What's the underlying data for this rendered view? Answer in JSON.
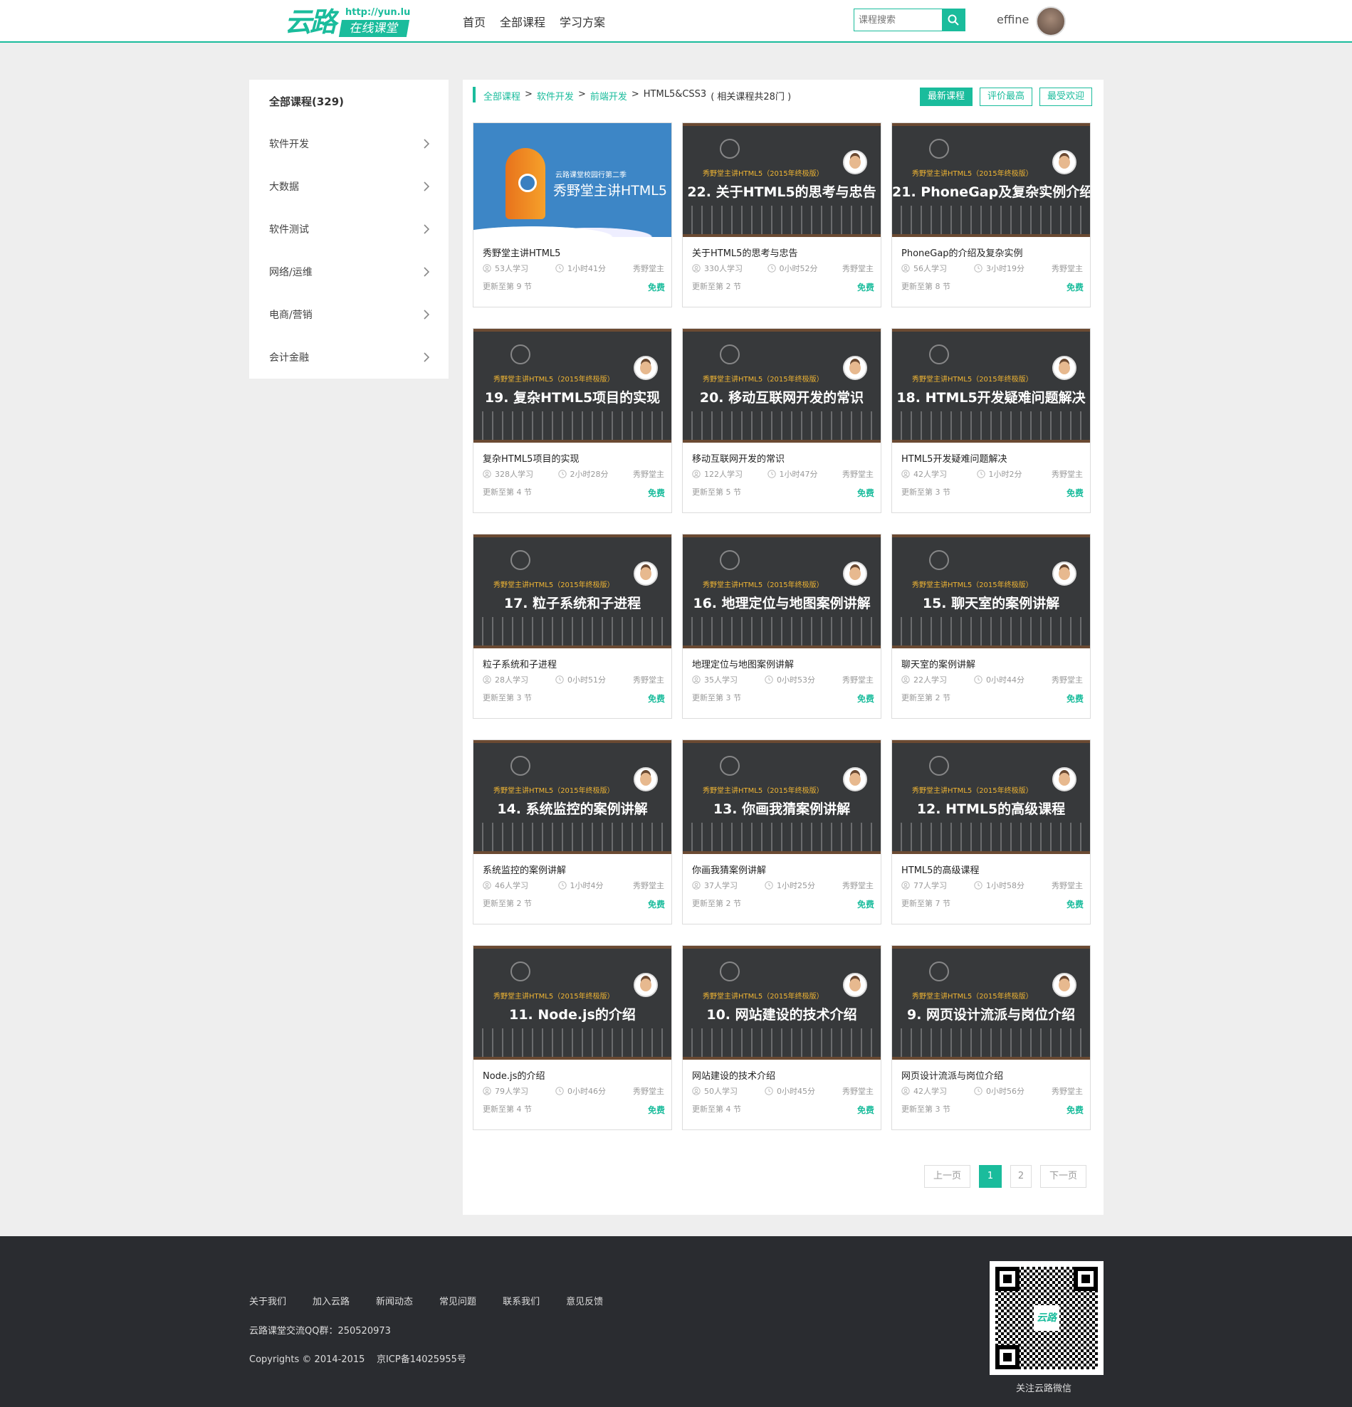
{
  "header": {
    "logo_main": "云路",
    "logo_url": "http://yun.lu",
    "logo_tag": "在线课堂",
    "nav": [
      "首页",
      "全部课程",
      "学习方案"
    ],
    "search_placeholder": "课程搜索",
    "username": "effine"
  },
  "sidebar": {
    "header": "全部课程(329)",
    "items": [
      "软件开发",
      "大数据",
      "软件测试",
      "网络/运维",
      "电商/营销",
      "会计金融"
    ]
  },
  "breadcrumb": {
    "items": [
      "全部课程",
      "软件开发",
      "前端开发",
      "HTML5&CSS3"
    ],
    "sep": ">",
    "count": "( 相关课程共28门 )"
  },
  "sort": [
    "最新课程",
    "评价最高",
    "最受欢迎"
  ],
  "courses": [
    {
      "thumb_sub": "云路课堂校园行第二季",
      "thumb_title": "秀野堂主讲HTML5",
      "title": "秀野堂主讲HTML5",
      "learners": "53人学习",
      "duration": "1小时41分",
      "teacher": "秀野堂主",
      "update": "更新至第 9 节",
      "price": "免费"
    },
    {
      "thumb_sub": "秀野堂主讲HTML5（2015年终极版）",
      "thumb_title": "22. 关于HTML5的思考与忠告",
      "title": "关于HTML5的思考与忠告",
      "learners": "330人学习",
      "duration": "0小时52分",
      "teacher": "秀野堂主",
      "update": "更新至第 2 节",
      "price": "免费"
    },
    {
      "thumb_sub": "秀野堂主讲HTML5（2015年终极版）",
      "thumb_title": "21. PhoneGap及复杂实例介绍",
      "title": "PhoneGap的介绍及复杂实例",
      "learners": "56人学习",
      "duration": "3小时19分",
      "teacher": "秀野堂主",
      "update": "更新至第 8 节",
      "price": "免费"
    },
    {
      "thumb_sub": "秀野堂主讲HTML5（2015年终极版）",
      "thumb_title": "19. 复杂HTML5项目的实现",
      "title": "复杂HTML5项目的实现",
      "learners": "328人学习",
      "duration": "2小时28分",
      "teacher": "秀野堂主",
      "update": "更新至第 4 节",
      "price": "免费"
    },
    {
      "thumb_sub": "秀野堂主讲HTML5（2015年终极版）",
      "thumb_title": "20. 移动互联网开发的常识",
      "title": "移动互联网开发的常识",
      "learners": "122人学习",
      "duration": "1小时47分",
      "teacher": "秀野堂主",
      "update": "更新至第 5 节",
      "price": "免费"
    },
    {
      "thumb_sub": "秀野堂主讲HTML5（2015年终极版）",
      "thumb_title": "18. HTML5开发疑难问题解决",
      "title": "HTML5开发疑难问题解决",
      "learners": "42人学习",
      "duration": "1小时2分",
      "teacher": "秀野堂主",
      "update": "更新至第 3 节",
      "price": "免费"
    },
    {
      "thumb_sub": "秀野堂主讲HTML5（2015年终极版）",
      "thumb_title": "17. 粒子系统和子进程",
      "title": "粒子系统和子进程",
      "learners": "28人学习",
      "duration": "0小时51分",
      "teacher": "秀野堂主",
      "update": "更新至第 3 节",
      "price": "免费"
    },
    {
      "thumb_sub": "秀野堂主讲HTML5（2015年终极版）",
      "thumb_title": "16. 地理定位与地图案例讲解",
      "title": "地理定位与地图案例讲解",
      "learners": "35人学习",
      "duration": "0小时53分",
      "teacher": "秀野堂主",
      "update": "更新至第 3 节",
      "price": "免费"
    },
    {
      "thumb_sub": "秀野堂主讲HTML5（2015年终极版）",
      "thumb_title": "15. 聊天室的案例讲解",
      "title": "聊天室的案例讲解",
      "learners": "22人学习",
      "duration": "0小时44分",
      "teacher": "秀野堂主",
      "update": "更新至第 2 节",
      "price": "免费"
    },
    {
      "thumb_sub": "秀野堂主讲HTML5（2015年终极版）",
      "thumb_title": "14. 系统监控的案例讲解",
      "title": "系统监控的案例讲解",
      "learners": "46人学习",
      "duration": "1小时4分",
      "teacher": "秀野堂主",
      "update": "更新至第 2 节",
      "price": "免费"
    },
    {
      "thumb_sub": "秀野堂主讲HTML5（2015年终极版）",
      "thumb_title": "13. 你画我猜案例讲解",
      "title": "你画我猜案例讲解",
      "learners": "37人学习",
      "duration": "1小时25分",
      "teacher": "秀野堂主",
      "update": "更新至第 2 节",
      "price": "免费"
    },
    {
      "thumb_sub": "秀野堂主讲HTML5（2015年终极版）",
      "thumb_title": "12. HTML5的高级课程",
      "title": "HTML5的高级课程",
      "learners": "77人学习",
      "duration": "1小时58分",
      "teacher": "秀野堂主",
      "update": "更新至第 7 节",
      "price": "免费"
    },
    {
      "thumb_sub": "秀野堂主讲HTML5（2015年终极版）",
      "thumb_title": "11. Node.js的介绍",
      "title": "Node.js的介绍",
      "learners": "79人学习",
      "duration": "0小时46分",
      "teacher": "秀野堂主",
      "update": "更新至第 4 节",
      "price": "免费"
    },
    {
      "thumb_sub": "秀野堂主讲HTML5（2015年终极版）",
      "thumb_title": "10. 网站建设的技术介绍",
      "title": "网站建设的技术介绍",
      "learners": "50人学习",
      "duration": "0小时45分",
      "teacher": "秀野堂主",
      "update": "更新至第 4 节",
      "price": "免费"
    },
    {
      "thumb_sub": "秀野堂主讲HTML5（2015年终极版）",
      "thumb_title": "9. 网页设计流派与岗位介绍",
      "title": "网页设计流派与岗位介绍",
      "learners": "42人学习",
      "duration": "0小时56分",
      "teacher": "秀野堂主",
      "update": "更新至第 3 节",
      "price": "免费"
    }
  ],
  "pager": {
    "prev": "上一页",
    "pages": [
      "1",
      "2"
    ],
    "current": "1",
    "next": "下一页"
  },
  "footer": {
    "links": [
      "关于我们",
      "加入云路",
      "新闻动态",
      "常见问题",
      "联系我们",
      "意见反馈"
    ],
    "qq": "云路课堂交流QQ群：250520973",
    "copyright": "Copyrights © 2014-2015    京ICP备14025955号",
    "qr_logo": "云路",
    "qr_caption": "关注云路微信"
  },
  "colors": {
    "accent": "#1abc9c",
    "footer_bg": "#2a2c30",
    "page_bg": "#eeeeee"
  }
}
